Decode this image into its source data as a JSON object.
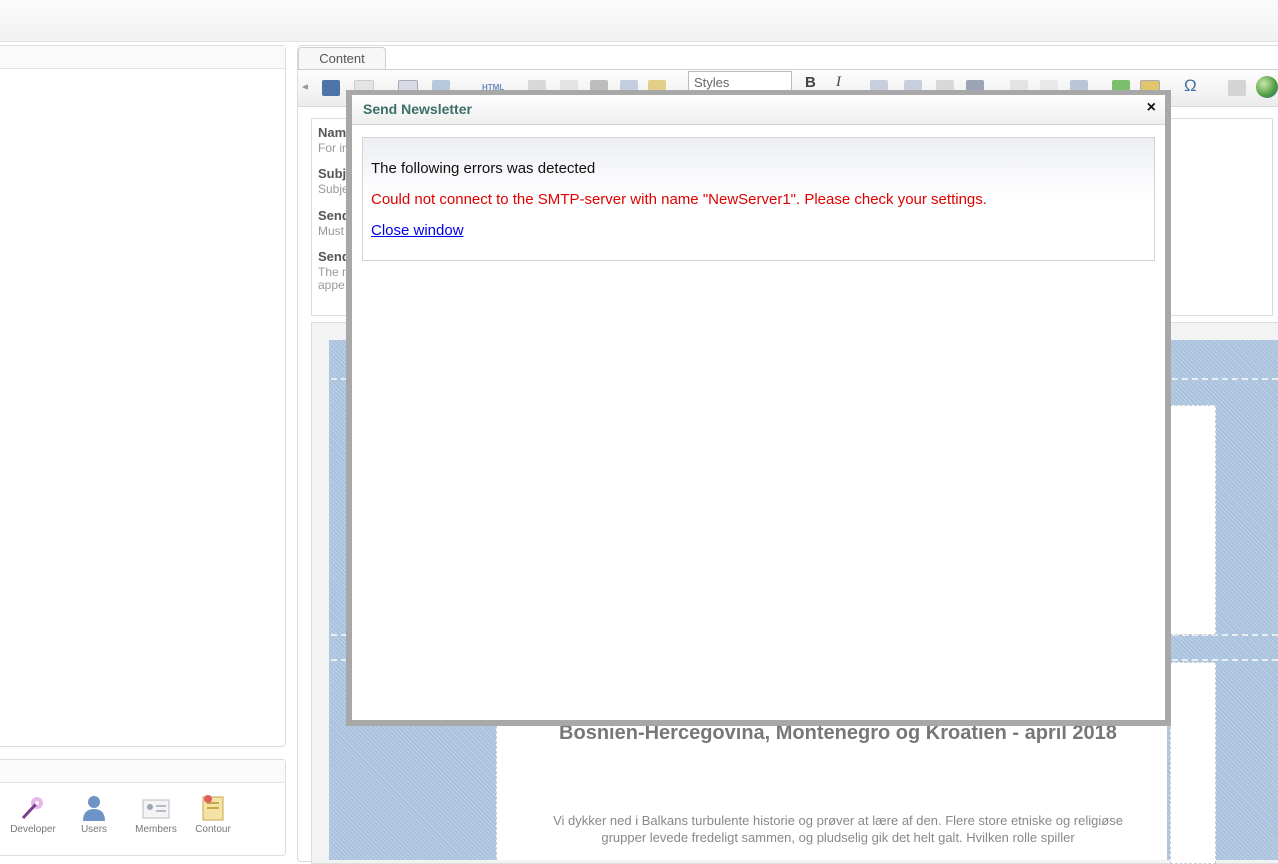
{
  "sections": {
    "items": [
      {
        "label": "Developer",
        "icon": "developer-icon"
      },
      {
        "label": "Users",
        "icon": "users-icon"
      },
      {
        "label": "Members",
        "icon": "members-icon"
      },
      {
        "label": "Contour",
        "icon": "contour-icon"
      }
    ]
  },
  "content_tab": {
    "label": "Content"
  },
  "toolbar": {
    "styles_label": "Styles",
    "bold_label": "B",
    "italic_label": "I",
    "omega_label": "Ω"
  },
  "fields": {
    "name": {
      "label": "Nam",
      "hint": "For in"
    },
    "subject": {
      "label": "Subj",
      "hint": "Subje"
    },
    "sender_email": {
      "label": "Send",
      "hint": "Must"
    },
    "sender_name": {
      "label": "Send",
      "hint": "The n",
      "hint2": "appe"
    }
  },
  "newsletter": {
    "title": "Bosnien-Hercegovina, Montenegro og Kroatien - april 2018",
    "body": "Vi dykker ned i Balkans turbulente historie og prøver at lære af den. Flere store etniske og religiøse grupper levede fredeligt sammen, og pludselig gik det helt galt. Hvilken rolle spiller"
  },
  "dialog": {
    "title": "Send Newsletter",
    "close_symbol": "×",
    "heading": "The following errors was detected",
    "error": "Could not connect to the SMTP-server with name \"NewServer1\". Please check your settings.",
    "close_link": "Close window"
  },
  "colors": {
    "dialog_title": "#3a6f6a",
    "error": "#e00000",
    "link": "#0000ee",
    "newsletter_bg": "#a8c2de"
  }
}
